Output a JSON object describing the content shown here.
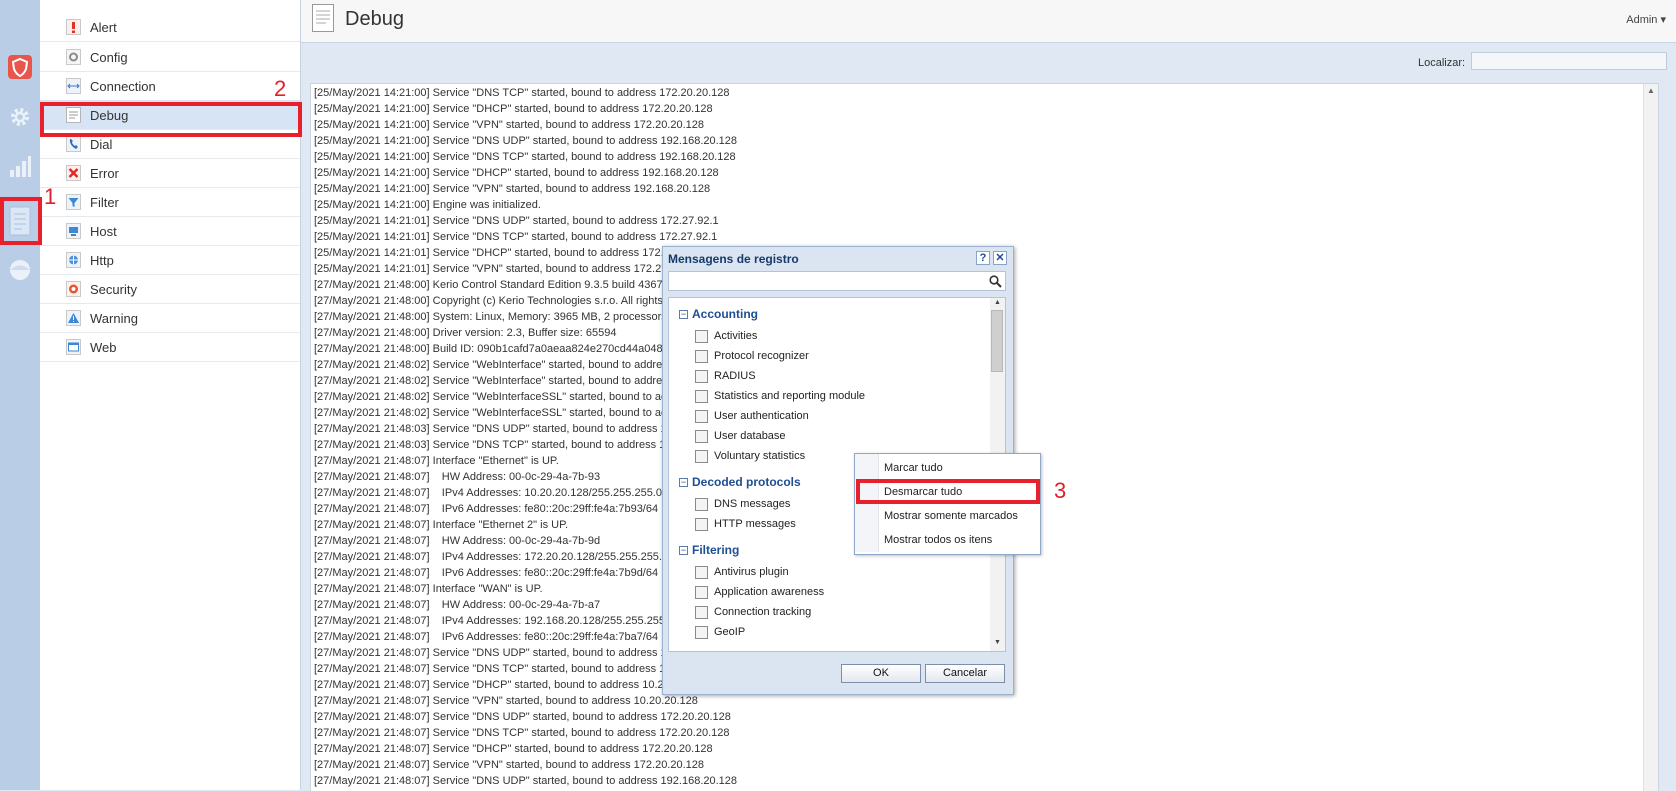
{
  "header": {
    "title": "Debug",
    "user_menu": "Admin ▾"
  },
  "toolbar": {
    "find_label": "Localizar:",
    "find_value": ""
  },
  "sidebar": {
    "items": [
      {
        "label": "Alert",
        "icon": "alert-icon"
      },
      {
        "label": "Config",
        "icon": "config-icon"
      },
      {
        "label": "Connection",
        "icon": "connection-icon"
      },
      {
        "label": "Debug",
        "icon": "debug-icon",
        "selected": true
      },
      {
        "label": "Dial",
        "icon": "dial-icon"
      },
      {
        "label": "Error",
        "icon": "error-icon"
      },
      {
        "label": "Filter",
        "icon": "filter-icon"
      },
      {
        "label": "Host",
        "icon": "host-icon"
      },
      {
        "label": "Http",
        "icon": "http-icon"
      },
      {
        "label": "Security",
        "icon": "security-icon"
      },
      {
        "label": "Warning",
        "icon": "warning-icon"
      },
      {
        "label": "Web",
        "icon": "web-icon"
      }
    ]
  },
  "rail": {
    "icons": [
      "shield-icon",
      "gear-icon",
      "bar-chart-icon",
      "logs-icon",
      "status-icon"
    ]
  },
  "annotations": {
    "one": "1",
    "two": "2",
    "three": "3",
    "color": "#e8202b"
  },
  "log_lines": [
    "[25/May/2021 14:21:00] Service \"DNS TCP\" started, bound to address 172.20.20.128",
    "[25/May/2021 14:21:00] Service \"DHCP\" started, bound to address 172.20.20.128",
    "[25/May/2021 14:21:00] Service \"VPN\" started, bound to address 172.20.20.128",
    "[25/May/2021 14:21:00] Service \"DNS UDP\" started, bound to address 192.168.20.128",
    "[25/May/2021 14:21:00] Service \"DNS TCP\" started, bound to address 192.168.20.128",
    "[25/May/2021 14:21:00] Service \"DHCP\" started, bound to address 192.168.20.128",
    "[25/May/2021 14:21:00] Service \"VPN\" started, bound to address 192.168.20.128",
    "[25/May/2021 14:21:00] Engine was initialized.",
    "[25/May/2021 14:21:01] Service \"DNS UDP\" started, bound to address 172.27.92.1",
    "[25/May/2021 14:21:01] Service \"DNS TCP\" started, bound to address 172.27.92.1",
    "[25/May/2021 14:21:01] Service \"DHCP\" started, bound to address 172.2",
    "[25/May/2021 14:21:01] Service \"VPN\" started, bound to address 172.27",
    "[27/May/2021 21:48:00] Kerio Control Standard Edition 9.3.5 build 4367",
    "[27/May/2021 21:48:00] Copyright (c) Kerio Technologies s.r.o. All rights",
    "[27/May/2021 21:48:00] System: Linux, Memory: 3965 MB, 2 processors",
    "[27/May/2021 21:48:00] Driver version: 2.3, Buffer size: 65594",
    "[27/May/2021 21:48:00] Build ID: 090b1cafd7a0aeaa824e270cd44a0486",
    "[27/May/2021 21:48:02] Service \"WebInterface\" started, bound to addres",
    "[27/May/2021 21:48:02] Service \"WebInterface\" started, bound to addre",
    "[27/May/2021 21:48:02] Service \"WebInterfaceSSL\" started, bound to ac",
    "[27/May/2021 21:48:02] Service \"WebInterfaceSSL\" started, bound to ac",
    "[27/May/2021 21:48:03] Service \"DNS UDP\" started, bound to address 1:",
    "[27/May/2021 21:48:03] Service \"DNS TCP\" started, bound to address 1:",
    "[27/May/2021 21:48:07] Interface \"Ethernet\" is UP.",
    "[27/May/2021 21:48:07]    HW Address: 00-0c-29-4a-7b-93",
    "[27/May/2021 21:48:07]    IPv4 Addresses: 10.20.20.128/255.255.255.0",
    "[27/May/2021 21:48:07]    IPv6 Addresses: fe80::20c:29ff:fe4a:7b93/64",
    "[27/May/2021 21:48:07] Interface \"Ethernet 2\" is UP.",
    "[27/May/2021 21:48:07]    HW Address: 00-0c-29-4a-7b-9d",
    "[27/May/2021 21:48:07]    IPv4 Addresses: 172.20.20.128/255.255.255.",
    "[27/May/2021 21:48:07]    IPv6 Addresses: fe80::20c:29ff:fe4a:7b9d/64",
    "[27/May/2021 21:48:07] Interface \"WAN\" is UP.",
    "[27/May/2021 21:48:07]    HW Address: 00-0c-29-4a-7b-a7",
    "[27/May/2021 21:48:07]    IPv4 Addresses: 192.168.20.128/255.255.255.",
    "[27/May/2021 21:48:07]    IPv6 Addresses: fe80::20c:29ff:fe4a:7ba7/64",
    "[27/May/2021 21:48:07] Service \"DNS UDP\" started, bound to address 10",
    "[27/May/2021 21:48:07] Service \"DNS TCP\" started, bound to address 10",
    "[27/May/2021 21:48:07] Service \"DHCP\" started, bound to address 10.20",
    "[27/May/2021 21:48:07] Service \"VPN\" started, bound to address 10.20.20.128",
    "[27/May/2021 21:48:07] Service \"DNS UDP\" started, bound to address 172.20.20.128",
    "[27/May/2021 21:48:07] Service \"DNS TCP\" started, bound to address 172.20.20.128",
    "[27/May/2021 21:48:07] Service \"DHCP\" started, bound to address 172.20.20.128",
    "[27/May/2021 21:48:07] Service \"VPN\" started, bound to address 172.20.20.128",
    "[27/May/2021 21:48:07] Service \"DNS UDP\" started, bound to address 192.168.20.128"
  ],
  "dialog": {
    "title": "Mensagens de registro",
    "help_label": "?",
    "close_label": "✕",
    "search_value": "",
    "ok_label": "OK",
    "cancel_label": "Cancelar",
    "groups": [
      {
        "label": "Accounting",
        "toggle": "−",
        "items": [
          "Activities",
          "Protocol recognizer",
          "RADIUS",
          "Statistics and reporting module",
          "User authentication",
          "User database",
          "Voluntary statistics"
        ]
      },
      {
        "label": "Decoded protocols",
        "toggle": "−",
        "items": [
          "DNS messages",
          "HTTP messages"
        ]
      },
      {
        "label": "Filtering",
        "toggle": "−",
        "items": [
          "Antivirus plugin",
          "Application awareness",
          "Connection tracking",
          "GeoIP"
        ]
      }
    ]
  },
  "context_menu": {
    "items": [
      "Marcar tudo",
      "Desmarcar tudo",
      "Mostrar somente marcados",
      "Mostrar todos os itens"
    ]
  }
}
